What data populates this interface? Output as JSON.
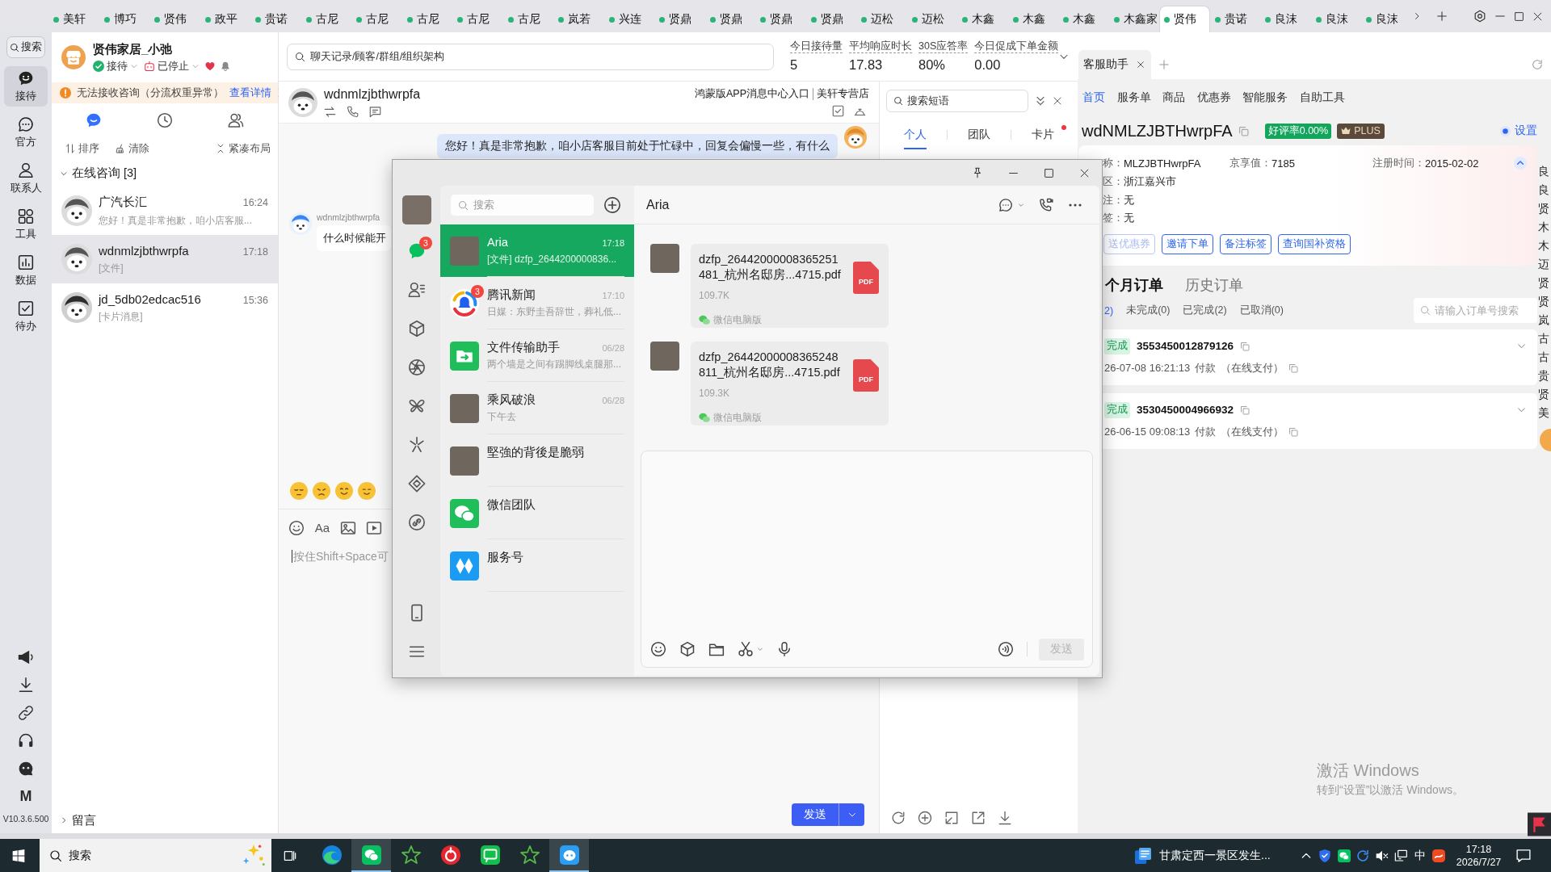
{
  "tab_strip": {
    "tabs": [
      {
        "label": "美轩",
        "selected": false
      },
      {
        "label": "博巧",
        "selected": false
      },
      {
        "label": "贤伟",
        "selected": false
      },
      {
        "label": "政平",
        "selected": false
      },
      {
        "label": "贵诺",
        "selected": false
      },
      {
        "label": "古尼",
        "selected": false
      },
      {
        "label": "古尼",
        "selected": false
      },
      {
        "label": "古尼",
        "selected": false
      },
      {
        "label": "古尼",
        "selected": false
      },
      {
        "label": "古尼",
        "selected": false
      },
      {
        "label": "岚若",
        "selected": false
      },
      {
        "label": "兴连",
        "selected": false
      },
      {
        "label": "贤鼎",
        "selected": false
      },
      {
        "label": "贤鼎",
        "selected": false
      },
      {
        "label": "贤鼎",
        "selected": false
      },
      {
        "label": "贤鼎",
        "selected": false
      },
      {
        "label": "迈松",
        "selected": false
      },
      {
        "label": "迈松",
        "selected": false
      },
      {
        "label": "木鑫",
        "selected": false
      },
      {
        "label": "木鑫",
        "selected": false
      },
      {
        "label": "木鑫",
        "selected": false
      },
      {
        "label": "木鑫家",
        "selected": false
      },
      {
        "label": "贤伟",
        "selected": true
      },
      {
        "label": "贵诺",
        "selected": false
      },
      {
        "label": "良沫",
        "selected": false
      },
      {
        "label": "良沫",
        "selected": false
      },
      {
        "label": "良沫",
        "selected": false
      }
    ]
  },
  "sidebar": {
    "search": "搜索",
    "items": [
      {
        "label": "接待",
        "selected": true
      },
      {
        "label": "官方",
        "selected": false
      },
      {
        "label": "联系人",
        "selected": false
      },
      {
        "label": "工具",
        "selected": false
      },
      {
        "label": "数据",
        "selected": false
      },
      {
        "label": "待办",
        "selected": false
      }
    ],
    "logo_letter": "M",
    "version": "V10.3.6.500"
  },
  "chat_list": {
    "account": {
      "name": "贤伟家居_小弛",
      "reception": "接待",
      "robot": "已停止"
    },
    "alert": {
      "text": "无法接收咨询（分流权重异常）",
      "link": "查看详情"
    },
    "view_tabs": [
      {
        "selected": true
      },
      {
        "selected": false
      },
      {
        "selected": false
      }
    ],
    "tools": [
      "排序",
      "清除",
      "紧凑布局"
    ],
    "section": {
      "title": "在线咨询 [3]",
      "expanded": true
    },
    "conversations": [
      {
        "name": "广汽长汇",
        "time": "16:24",
        "preview": "您好！真是非常抱歉，咱小店客服...",
        "selected": false
      },
      {
        "name": "wdnmlzjbthwrpfa",
        "time": "17:18",
        "preview": "[文件]",
        "selected": true
      },
      {
        "name": "jd_5db02edcac516",
        "time": "15:36",
        "preview": "[卡片消息]",
        "selected": false
      }
    ],
    "footer": {
      "title": "留言",
      "expanded": false
    }
  },
  "top_bar": {
    "search": {
      "placeholder": "聊天记录/顾客/群组/组织架构"
    },
    "stats": [
      {
        "label": "今日接待量",
        "value": "5"
      },
      {
        "label": "平均响应时长",
        "value": "17.83"
      },
      {
        "label": "30S应答率",
        "value": "80%"
      },
      {
        "label": "今日促成下单金额",
        "value": "0.00"
      }
    ]
  },
  "chat": {
    "customer": "wdnmlzjbthwrpfa",
    "links": [
      "鸿蒙版APP消息中心入口",
      "美轩专营店"
    ],
    "messages": [
      {
        "kind": "agent",
        "text": "您好！真是非常抱歉，咱小店客服目前处于忙碌中，回复会偏慢一些，有什么"
      },
      {
        "kind": "customer",
        "sender": "wdnmlzjbthwrpfa",
        "text": "什么时候能开"
      }
    ],
    "format_label": "Aa",
    "input": {
      "placeholder": "按住Shift+Space可"
    },
    "send": "发送"
  },
  "phrases": {
    "search": {
      "placeholder": "搜索短语"
    },
    "tabs": [
      {
        "label": "个人",
        "selected": true,
        "dot": false
      },
      {
        "label": "团队",
        "selected": false,
        "dot": false
      },
      {
        "label": "卡片",
        "selected": false,
        "dot": true
      }
    ]
  },
  "assistant": {
    "tabs": [
      {
        "label": "客服助手",
        "selected": true
      }
    ],
    "nav": [
      {
        "label": "首页",
        "selected": true
      },
      {
        "label": "服务单",
        "selected": false
      },
      {
        "label": "商品",
        "selected": false
      },
      {
        "label": "优惠券",
        "selected": false
      },
      {
        "label": "智能服务",
        "selected": false
      },
      {
        "label": "自助工具",
        "selected": false
      }
    ],
    "customer": {
      "name": "wdNMLZJBTHwrpFA",
      "rating": "好评率0.00%",
      "member": "PLUS",
      "settings": "设置"
    },
    "info_rows": [
      [
        {
          "label": "称：",
          "value": "MLZJBTHwrpFA"
        },
        {
          "label": "京享值：",
          "value": "7185"
        },
        {
          "label": "注册时间：",
          "value": "2015-02-02"
        }
      ],
      [
        {
          "label": "区：",
          "value": "浙江嘉兴市"
        }
      ],
      [
        {
          "label": "注：",
          "value": "无"
        }
      ],
      [
        {
          "label": "签：",
          "value": "无"
        }
      ]
    ],
    "info_expanded": true,
    "actions": [
      {
        "label": "送优惠券",
        "disabled": true
      },
      {
        "label": "邀请下单",
        "disabled": false
      },
      {
        "label": "备注标签",
        "disabled": false
      },
      {
        "label": "查询国补资格",
        "disabled": false
      }
    ],
    "orders": {
      "tabs": [
        {
          "label": "个月订单",
          "selected": true
        },
        {
          "label": "历史订单",
          "selected": false
        }
      ],
      "filters": [
        {
          "label": "2)",
          "selected": true
        },
        {
          "label": "未完成(0)",
          "selected": false
        },
        {
          "label": "已完成(2)",
          "selected": false
        },
        {
          "label": "已取消(0)",
          "selected": false
        }
      ],
      "search": {
        "placeholder": "请输入订单号搜索"
      },
      "items": [
        {
          "status": "完成",
          "number": "3553450012879126",
          "time": "26-07-08 16:21:13",
          "action": "付款",
          "method": "（在线支付）",
          "expanded": false
        },
        {
          "status": "完成",
          "number": "3530450004966932",
          "time": "26-06-15 09:08:13",
          "action": "付款",
          "method": "（在线支付）",
          "expanded": false
        }
      ]
    }
  },
  "edge_strip": {
    "labels": [
      "良",
      "良",
      "贤",
      "木",
      "木",
      "迈",
      "贤",
      "贤",
      "岚",
      "古",
      "古",
      "贵",
      "贤",
      "美"
    ]
  },
  "wechat": {
    "nav": [
      {
        "selected": true,
        "badge": "3"
      },
      {
        "selected": false
      },
      {
        "selected": false
      },
      {
        "selected": false
      },
      {
        "selected": false
      },
      {
        "selected": false
      },
      {
        "selected": false
      },
      {
        "selected": false
      }
    ],
    "search": {
      "placeholder": "搜索"
    },
    "chats": [
      {
        "kind": "photo",
        "name": "Aria",
        "time": "17:18",
        "preview": "[文件] dzfp_2644200000836...",
        "selected": true
      },
      {
        "kind": "logo",
        "name": "腾讯新闻",
        "time": "17:10",
        "preview": "日媒：东野圭吾辞世，葬礼低...",
        "badge": "3",
        "selected": false
      },
      {
        "kind": "logo",
        "name": "文件传输助手",
        "time": "06/28",
        "preview": "两个墙是之间有踢脚线桌腿那...",
        "selected": false
      },
      {
        "kind": "photo",
        "name": "乘风破浪",
        "time": "06/28",
        "preview": "下午去",
        "selected": false
      },
      {
        "kind": "photo",
        "name": "堅強的背後是脆弱",
        "selected": false
      },
      {
        "kind": "logo",
        "name": "微信团队",
        "selected": false
      },
      {
        "kind": "logo",
        "name": "服务号",
        "selected": false
      }
    ],
    "title": "Aria",
    "messages": [
      {
        "file": "dzfp_26442000008365251481_杭州名邸房...4715.pdf",
        "type": "PDF",
        "size": "109.7K",
        "source": "微信电脑版"
      },
      {
        "file": "dzfp_26442000008365248811_杭州名邸房...4715.pdf",
        "type": "PDF",
        "size": "109.3K",
        "source": "微信电脑版"
      }
    ],
    "send": "发送",
    "send_disabled": true
  },
  "os": {
    "activation": {
      "title": "激活 Windows",
      "hint": "转到“设置”以激活 Windows。"
    },
    "taskbar": {
      "search": "搜索",
      "apps": [
        {
          "active": false
        },
        {
          "active": true
        },
        {
          "active": false
        },
        {
          "active": false
        },
        {
          "active": false
        },
        {
          "active": false
        },
        {
          "active": true
        }
      ],
      "news": "甘肃定西一景区发生...",
      "ime": "中",
      "time": "17:18",
      "date": "2026/7/27"
    }
  }
}
